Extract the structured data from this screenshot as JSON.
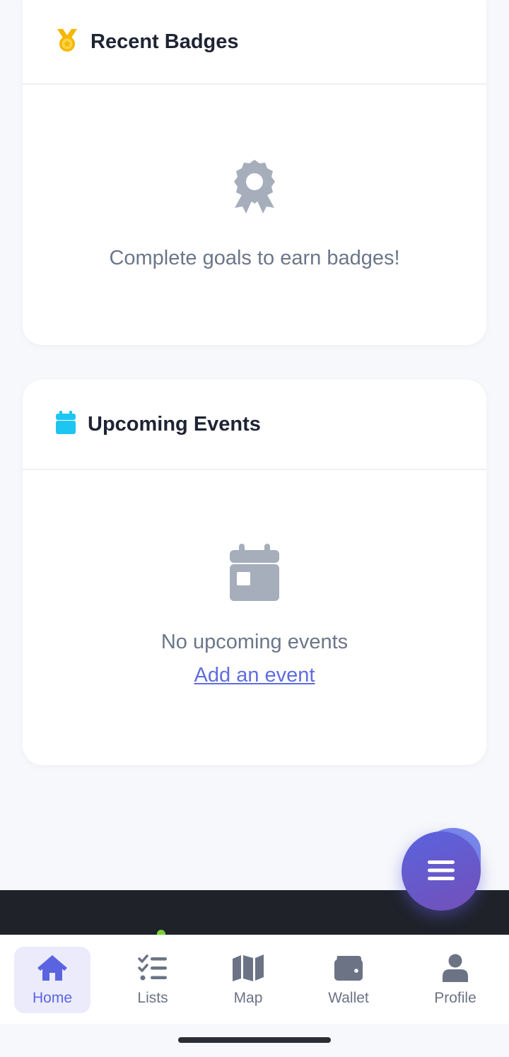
{
  "badges_card": {
    "title": "Recent Badges",
    "title_icon": "medal-icon",
    "empty_icon": "award-icon",
    "empty_text": "Complete goals to earn badges!"
  },
  "events_card": {
    "title": "Upcoming Events",
    "title_icon": "calendar-icon",
    "empty_icon": "calendar-day-icon",
    "empty_text": "No upcoming events",
    "add_link": "Add an event"
  },
  "fab": {
    "icon": "menu-icon"
  },
  "bottom_nav": {
    "items": [
      {
        "label": "Home",
        "icon": "home-icon",
        "active": true
      },
      {
        "label": "Lists",
        "icon": "list-check-icon",
        "active": false
      },
      {
        "label": "Map",
        "icon": "map-icon",
        "active": false
      },
      {
        "label": "Wallet",
        "icon": "wallet-icon",
        "active": false
      },
      {
        "label": "Profile",
        "icon": "user-icon",
        "active": false
      }
    ]
  },
  "colors": {
    "accent": "#5b64e0",
    "medal": "#f5b700",
    "calendar": "#1cc6f0",
    "muted_icon": "#a6adbb",
    "muted_text": "#6b7689"
  }
}
